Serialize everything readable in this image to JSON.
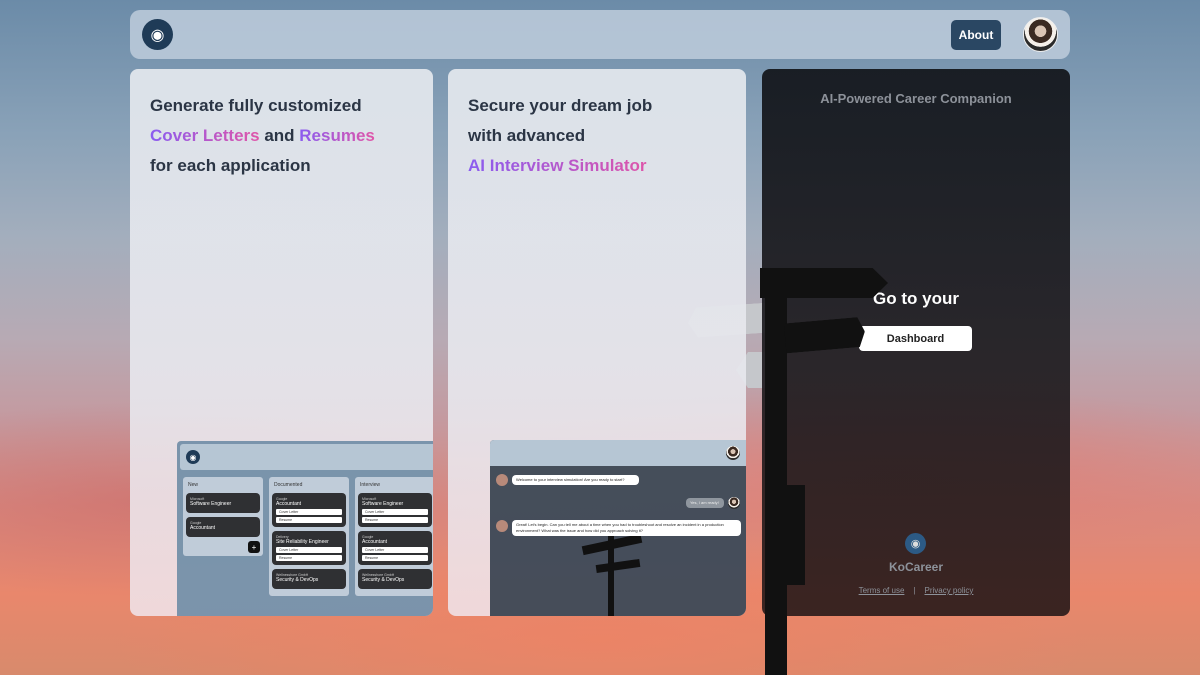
{
  "topbar": {
    "logo_icon": "tie-icon",
    "about_label": "About",
    "avatar_alt": "user-avatar"
  },
  "card_documents": {
    "line1": "Generate fully customized",
    "highlight1": "Cover Letters",
    "connector": " and ",
    "highlight2": "Resumes",
    "line3": "for each application",
    "preview": {
      "columns": [
        {
          "title": "New",
          "jobs": [
            {
              "company": "Microsoft",
              "title": "Software Engineer",
              "docs": []
            },
            {
              "company": "Google",
              "title": "Accountant",
              "docs": []
            }
          ],
          "add_label": "+"
        },
        {
          "title": "Documented",
          "jobs": [
            {
              "company": "Google",
              "title": "Accountant",
              "docs": [
                "Cover Letter",
                "Resume"
              ]
            },
            {
              "company": "Delivery",
              "title": "Site Reliability Engineer",
              "docs": [
                "Cover Letter",
                "Resume"
              ]
            },
            {
              "company": "Wellnesshore GmbH",
              "title": "Security & DevOps",
              "docs": []
            }
          ]
        },
        {
          "title": "Interview",
          "jobs": [
            {
              "company": "Microsoft",
              "title": "Software Engineer",
              "docs": [
                "Cover Letter",
                "Resume"
              ]
            },
            {
              "company": "Google",
              "title": "Accountant",
              "docs": [
                "Cover Letter",
                "Resume"
              ]
            },
            {
              "company": "Wellnesshore GmbH",
              "title": "Security & DevOps",
              "docs": []
            }
          ]
        }
      ]
    }
  },
  "card_interview": {
    "line1": "Secure your dream job",
    "line2": "with advanced",
    "highlight": "AI Interview Simulator",
    "chat": [
      {
        "from": "bot",
        "text": "Welcome to your interview simulation! Are you ready to start?"
      },
      {
        "from": "user",
        "text": "Yes, I am ready!"
      },
      {
        "from": "bot",
        "text": "Great! Let's begin. Can you tell me about a time when you had to troubleshoot and resolve an incident in a production environment? What was the issue and how did you approach solving it?"
      }
    ]
  },
  "card_dashboard": {
    "tagline": "AI-Powered Career Companion",
    "goto_text": "Go to your",
    "dashboard_label": "Dashboard",
    "brand": "KoCareer",
    "terms_label": "Terms of use",
    "separator": "|",
    "privacy_label": "Privacy policy"
  }
}
